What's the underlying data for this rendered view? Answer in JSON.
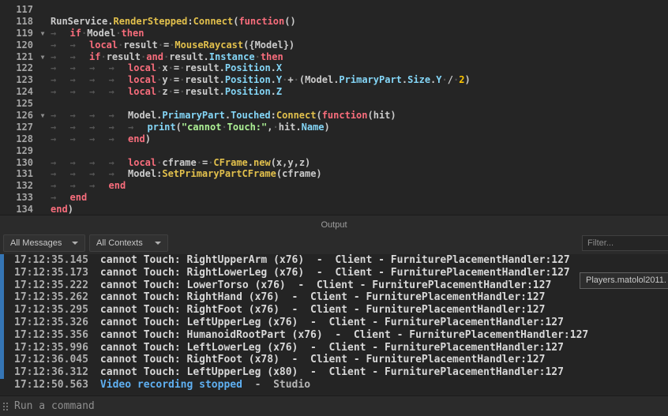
{
  "colors": {
    "keyword": "#f86d7c",
    "property": "#84d6f7",
    "method": "#e2c04c",
    "number": "#ffc600",
    "string": "#adf195",
    "text": "#cbcbcb",
    "whitespace": "#555555",
    "line-number": "#a5a5a5",
    "info": "#5fb0f2",
    "accent-bar": "#3575b5",
    "timestamp": "#adadad",
    "message": "#d8d8d8",
    "editor-bg": "#252525",
    "panel-bg": "#2b2b2b",
    "log-bg": "#242424",
    "border": "#1b1b1b",
    "control-bg": "#313131",
    "control-border": "#404040"
  },
  "editor": {
    "fold_lines": [
      119,
      121,
      126
    ],
    "lines": [
      {
        "num": 117,
        "indent": 0,
        "tokens": []
      },
      {
        "num": 118,
        "indent": 0,
        "tokens": [
          [
            "txt",
            "RunService."
          ],
          [
            "fn",
            "RenderStepped"
          ],
          [
            "txt",
            ":"
          ],
          [
            "fn",
            "Connect"
          ],
          [
            "txt",
            "("
          ],
          [
            "kw",
            "function"
          ],
          [
            "txt",
            "()"
          ]
        ]
      },
      {
        "num": 119,
        "indent": 1,
        "tokens": [
          [
            "kw",
            "if"
          ],
          [
            "ws",
            "·"
          ],
          [
            "txt",
            "Model"
          ],
          [
            "ws",
            "·"
          ],
          [
            "kw",
            "then"
          ]
        ]
      },
      {
        "num": 120,
        "indent": 2,
        "tokens": [
          [
            "kw",
            "local"
          ],
          [
            "ws",
            "·"
          ],
          [
            "txt",
            "result"
          ],
          [
            "ws",
            "·"
          ],
          [
            "txt",
            "="
          ],
          [
            "ws",
            "·"
          ],
          [
            "fn",
            "MouseRaycast"
          ],
          [
            "txt",
            "({Model})"
          ]
        ]
      },
      {
        "num": 121,
        "indent": 2,
        "tokens": [
          [
            "kw",
            "if"
          ],
          [
            "ws",
            "·"
          ],
          [
            "txt",
            "result"
          ],
          [
            "ws",
            "·"
          ],
          [
            "kw",
            "and"
          ],
          [
            "ws",
            "·"
          ],
          [
            "txt",
            "result."
          ],
          [
            "prop",
            "Instance"
          ],
          [
            "ws",
            "·"
          ],
          [
            "kw",
            "then"
          ]
        ]
      },
      {
        "num": 122,
        "indent": 4,
        "tokens": [
          [
            "kw",
            "local"
          ],
          [
            "ws",
            "·"
          ],
          [
            "txt",
            "x"
          ],
          [
            "ws",
            "·"
          ],
          [
            "txt",
            "="
          ],
          [
            "ws",
            "·"
          ],
          [
            "txt",
            "result."
          ],
          [
            "prop",
            "Position"
          ],
          [
            "txt",
            "."
          ],
          [
            "prop",
            "X"
          ]
        ]
      },
      {
        "num": 123,
        "indent": 4,
        "tokens": [
          [
            "kw",
            "local"
          ],
          [
            "ws",
            "·"
          ],
          [
            "txt",
            "y"
          ],
          [
            "ws",
            "·"
          ],
          [
            "txt",
            "="
          ],
          [
            "ws",
            "·"
          ],
          [
            "txt",
            "result."
          ],
          [
            "prop",
            "Position"
          ],
          [
            "txt",
            "."
          ],
          [
            "prop",
            "Y"
          ],
          [
            "ws",
            "·"
          ],
          [
            "txt",
            "+"
          ],
          [
            "ws",
            "·"
          ],
          [
            "txt",
            "(Model."
          ],
          [
            "prop",
            "PrimaryPart"
          ],
          [
            "txt",
            "."
          ],
          [
            "prop",
            "Size"
          ],
          [
            "txt",
            "."
          ],
          [
            "prop",
            "Y"
          ],
          [
            "ws",
            "·"
          ],
          [
            "txt",
            "/"
          ],
          [
            "ws",
            "·"
          ],
          [
            "num",
            "2"
          ],
          [
            "txt",
            ")"
          ]
        ]
      },
      {
        "num": 124,
        "indent": 4,
        "tokens": [
          [
            "kw",
            "local"
          ],
          [
            "ws",
            "·"
          ],
          [
            "txt",
            "z"
          ],
          [
            "ws",
            "·"
          ],
          [
            "txt",
            "="
          ],
          [
            "ws",
            "·"
          ],
          [
            "txt",
            "result."
          ],
          [
            "prop",
            "Position"
          ],
          [
            "txt",
            "."
          ],
          [
            "prop",
            "Z"
          ]
        ]
      },
      {
        "num": 125,
        "indent": 0,
        "tokens": []
      },
      {
        "num": 126,
        "indent": 4,
        "tokens": [
          [
            "txt",
            "Model."
          ],
          [
            "prop",
            "PrimaryPart"
          ],
          [
            "txt",
            "."
          ],
          [
            "prop",
            "Touched"
          ],
          [
            "txt",
            ":"
          ],
          [
            "fn",
            "Connect"
          ],
          [
            "txt",
            "("
          ],
          [
            "kw",
            "function"
          ],
          [
            "txt",
            "(hit)"
          ]
        ]
      },
      {
        "num": 127,
        "indent": 5,
        "tokens": [
          [
            "prop",
            "print"
          ],
          [
            "txt",
            "("
          ],
          [
            "str",
            "\"cannot"
          ],
          [
            "ws",
            "·"
          ],
          [
            "str",
            "Touch:\""
          ],
          [
            "txt",
            ","
          ],
          [
            "ws",
            "·"
          ],
          [
            "txt",
            "hit."
          ],
          [
            "prop",
            "Name"
          ],
          [
            "txt",
            ")"
          ]
        ]
      },
      {
        "num": 128,
        "indent": 4,
        "tokens": [
          [
            "kw",
            "end"
          ],
          [
            "txt",
            ")"
          ]
        ]
      },
      {
        "num": 129,
        "indent": 0,
        "tokens": []
      },
      {
        "num": 130,
        "indent": 4,
        "tokens": [
          [
            "kw",
            "local"
          ],
          [
            "ws",
            "·"
          ],
          [
            "txt",
            "cframe"
          ],
          [
            "ws",
            "·"
          ],
          [
            "txt",
            "="
          ],
          [
            "ws",
            "·"
          ],
          [
            "fn",
            "CFrame"
          ],
          [
            "txt",
            "."
          ],
          [
            "fn",
            "new"
          ],
          [
            "txt",
            "(x,y,z)"
          ]
        ]
      },
      {
        "num": 131,
        "indent": 4,
        "tokens": [
          [
            "txt",
            "Model:"
          ],
          [
            "fn",
            "SetPrimaryPartCFrame"
          ],
          [
            "txt",
            "(cframe)"
          ]
        ]
      },
      {
        "num": 132,
        "indent": 3,
        "tokens": [
          [
            "kw",
            "end"
          ]
        ]
      },
      {
        "num": 133,
        "indent": 1,
        "tokens": [
          [
            "kw",
            "end"
          ]
        ]
      },
      {
        "num": 134,
        "indent": 0,
        "tokens": [
          [
            "kw",
            "end"
          ],
          [
            "txt",
            ")"
          ]
        ]
      }
    ]
  },
  "output": {
    "title": "Output",
    "messages_filter": "All Messages",
    "contexts_filter": "All Contexts",
    "filter_placeholder": "Filter...",
    "tooltip": "Players.matolol2011.",
    "rows": [
      {
        "time": "17:12:35.145",
        "msg": "cannot Touch: RightUpperArm (x76)",
        "tail": "  -  Client - FurniturePlacementHandler:127"
      },
      {
        "time": "17:12:35.173",
        "msg": "cannot Touch: RightLowerLeg (x76)",
        "tail": "  -  Client - FurniturePlacementHandler:127"
      },
      {
        "time": "17:12:35.222",
        "msg": "cannot Touch: LowerTorso (x76)",
        "tail": "  -  Client - FurniturePlacementHandler:127"
      },
      {
        "time": "17:12:35.262",
        "msg": "cannot Touch: RightHand (x76)",
        "tail": "  -  Client - FurniturePlacementHandler:127"
      },
      {
        "time": "17:12:35.295",
        "msg": "cannot Touch: RightFoot (x76)",
        "tail": "  -  Client - FurniturePlacementHandler:127"
      },
      {
        "time": "17:12:35.326",
        "msg": "cannot Touch: LeftUpperLeg (x76)",
        "tail": "  -  Client - FurniturePlacementHandler:127"
      },
      {
        "time": "17:12:35.356",
        "msg": "cannot Touch: HumanoidRootPart (x76)",
        "tail": "  -  Client - FurniturePlacementHandler:127"
      },
      {
        "time": "17:12:35.996",
        "msg": "cannot Touch: LeftLowerLeg (x76)",
        "tail": "  -  Client - FurniturePlacementHandler:127"
      },
      {
        "time": "17:12:36.045",
        "msg": "cannot Touch: RightFoot (x78)",
        "tail": "  -  Client - FurniturePlacementHandler:127"
      },
      {
        "time": "17:12:36.312",
        "msg": "cannot Touch: LeftUpperLeg (x80)",
        "tail": "  -  Client - FurniturePlacementHandler:127"
      },
      {
        "time": "17:12:50.563",
        "msg": "Video recording stopped",
        "tail": "  -  Studio",
        "style": "info"
      }
    ]
  },
  "command_bar": {
    "placeholder": "Run a command"
  }
}
